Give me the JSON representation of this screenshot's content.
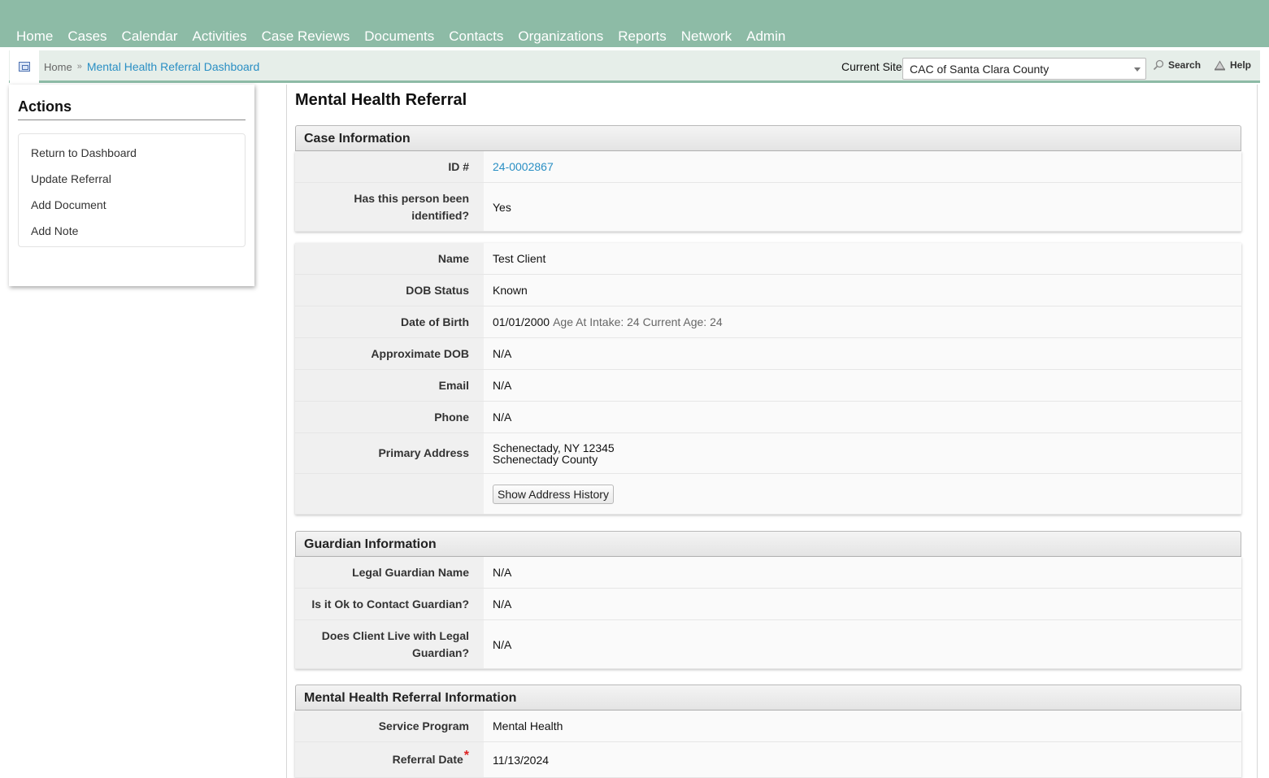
{
  "nav": {
    "items": [
      "Home",
      "Cases",
      "Calendar",
      "Activities",
      "Case Reviews",
      "Documents",
      "Contacts",
      "Organizations",
      "Reports",
      "Network",
      "Admin"
    ]
  },
  "breadcrumb": {
    "home": "Home",
    "separator": "»",
    "current": "Mental Health Referral Dashboard"
  },
  "site": {
    "label": "Current Site",
    "selected": "CAC of Santa Clara County"
  },
  "tools": {
    "search": "Search",
    "help": "Help"
  },
  "actions": {
    "title": "Actions",
    "items": [
      "Return to Dashboard",
      "Update Referral",
      "Add Document",
      "Add Note"
    ]
  },
  "page": {
    "title": "Mental Health Referral"
  },
  "case_info": {
    "header": "Case Information",
    "id_label": "ID #",
    "id_value": "24-0002867",
    "identified_label": "Has this person been identified?",
    "identified_value": "Yes"
  },
  "person": {
    "name_label": "Name",
    "name_value": "Test Client",
    "dob_status_label": "DOB Status",
    "dob_status_value": "Known",
    "dob_label": "Date of Birth",
    "dob_value": "01/01/2000",
    "dob_extra": "Age At Intake: 24 Current Age: 24",
    "approx_dob_label": "Approximate DOB",
    "approx_dob_value": "N/A",
    "email_label": "Email",
    "email_value": "N/A",
    "phone_label": "Phone",
    "phone_value": "N/A",
    "address_label": "Primary Address",
    "address_line1": "Schenectady, NY 12345",
    "address_line2": "Schenectady County",
    "address_history_button": "Show Address History"
  },
  "guardian": {
    "header": "Guardian Information",
    "name_label": "Legal Guardian Name",
    "name_value": "N/A",
    "contact_label": "Is it Ok to Contact Guardian?",
    "contact_value": "N/A",
    "lives_label": "Does Client Live with Legal Guardian?",
    "lives_value": "N/A"
  },
  "referral": {
    "header": "Mental Health Referral Information",
    "program_label": "Service Program",
    "program_value": "Mental Health",
    "date_label": "Referral Date",
    "date_required": "*",
    "date_value": "11/13/2024"
  },
  "icons": {
    "context": "context-menu-icon",
    "search": "magnifier-icon",
    "help": "lifebuoy-icon",
    "dropdown": "caret-down-icon"
  },
  "colors": {
    "nav_bg": "#8dbba6",
    "link": "#2a8fc4",
    "required": "#dd2222"
  }
}
